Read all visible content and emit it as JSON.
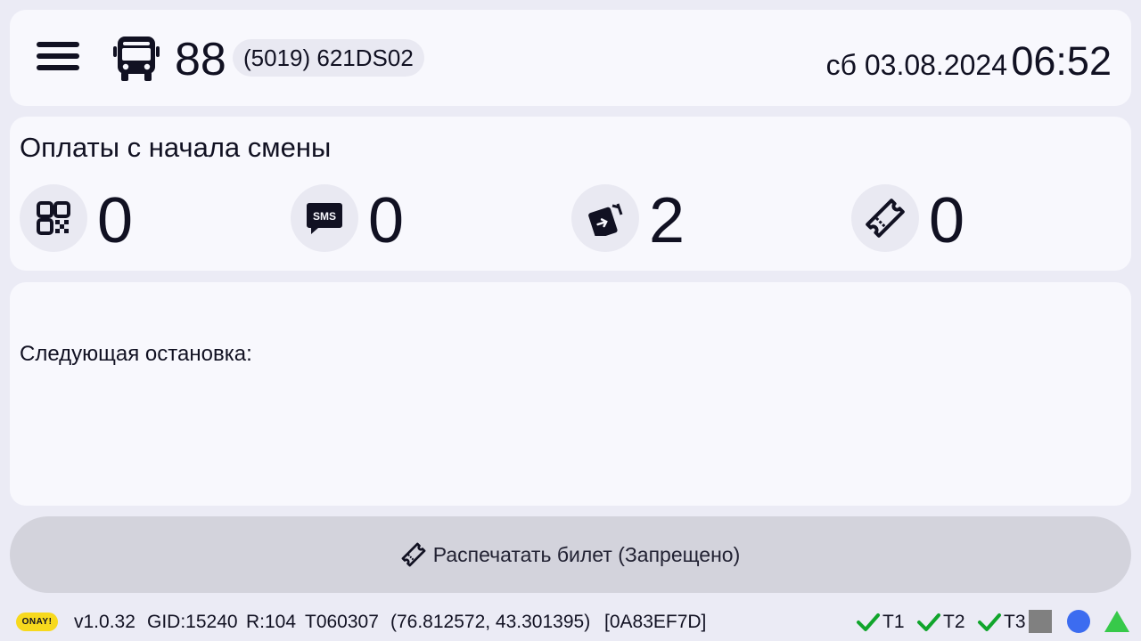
{
  "header": {
    "route_number": "88",
    "vehicle_id": "(5019) 621DS02",
    "date": "сб 03.08.2024",
    "time": "06:52"
  },
  "payments": {
    "title": "Оплаты с начала смены",
    "items": [
      {
        "icon": "qr-code-icon",
        "value": "0"
      },
      {
        "icon": "sms-icon",
        "value": "0"
      },
      {
        "icon": "card-tap-icon",
        "value": "2"
      },
      {
        "icon": "ticket-icon",
        "value": "0"
      }
    ]
  },
  "next_stop": {
    "label": "Следующая остановка:"
  },
  "print_button": {
    "label": "Распечатать билет (Запрещено)",
    "icon": "ticket-icon"
  },
  "status_bar": {
    "logo_text": "ONAY!",
    "version": "v1.0.32",
    "gid": "GID:15240",
    "r": "R:104",
    "terminal": "T060307",
    "coords": "(76.812572, 43.301395)",
    "hex_id": "[0A83EF7D]",
    "indicators": [
      {
        "label": "T1",
        "status": "ok"
      },
      {
        "label": "T2",
        "status": "ok"
      },
      {
        "label": "T3",
        "status": "ok"
      }
    ],
    "colors": {
      "check": "#11a52c",
      "square": "#808080",
      "dot": "#3c6cf0",
      "triangle": "#37c94a"
    }
  }
}
